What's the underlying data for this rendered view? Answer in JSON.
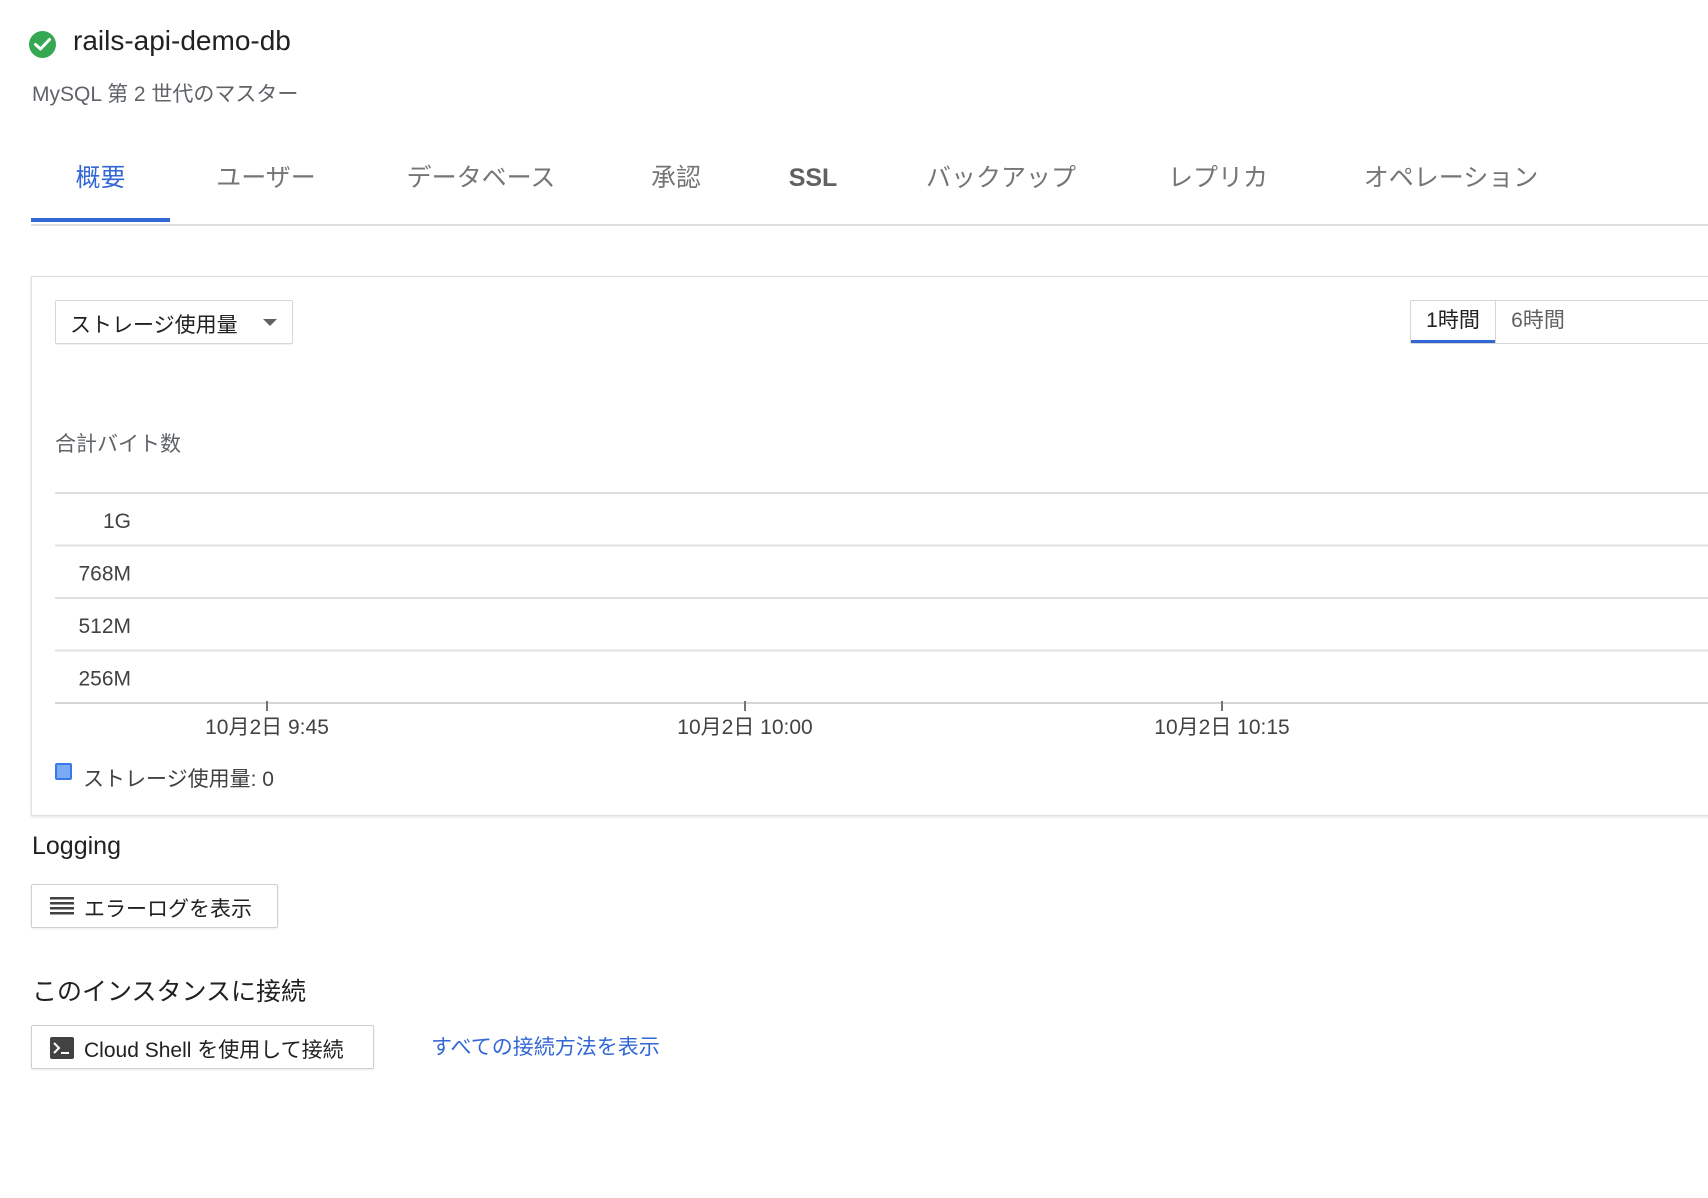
{
  "header": {
    "instance_name": "rails-api-demo-db",
    "subtitle": "MySQL 第 2 世代のマスター",
    "status_icon": "check-circle-icon",
    "status_color": "#34a853"
  },
  "tabs": [
    {
      "label": "概要",
      "active": true
    },
    {
      "label": "ユーザー"
    },
    {
      "label": "データベース"
    },
    {
      "label": "承認"
    },
    {
      "label": "SSL"
    },
    {
      "label": "バックアップ"
    },
    {
      "label": "レプリカ"
    },
    {
      "label": "オペレーション"
    }
  ],
  "accent_color": "#3367d6",
  "chart_panel": {
    "metric_select": {
      "selected": "ストレージ使用量"
    },
    "time_ranges": [
      {
        "label": "1時間",
        "active": true
      },
      {
        "label": "6時間"
      }
    ],
    "legend": {
      "label": "ストレージ使用量: 0",
      "swatch_color": "#7baaf7"
    }
  },
  "chart_data": {
    "type": "area",
    "ylabel": "合計バイト数",
    "y_ticks": [
      "1G",
      "768M",
      "512M",
      "256M"
    ],
    "x_ticks": [
      "10月2日 9:45",
      "10月2日 10:00",
      "10月2日 10:15"
    ],
    "series": [
      {
        "name": "ストレージ使用量",
        "values": [
          0,
          0,
          0
        ]
      }
    ],
    "grid": true
  },
  "logging": {
    "title": "Logging",
    "view_errors_button": "エラーログを表示",
    "button_icon": "list-icon"
  },
  "connect": {
    "title": "このインスタンスに接続",
    "cloud_shell_button": "Cloud Shell を使用して接続",
    "button_icon": "terminal-icon",
    "all_methods_link": "すべての接続方法を表示"
  }
}
